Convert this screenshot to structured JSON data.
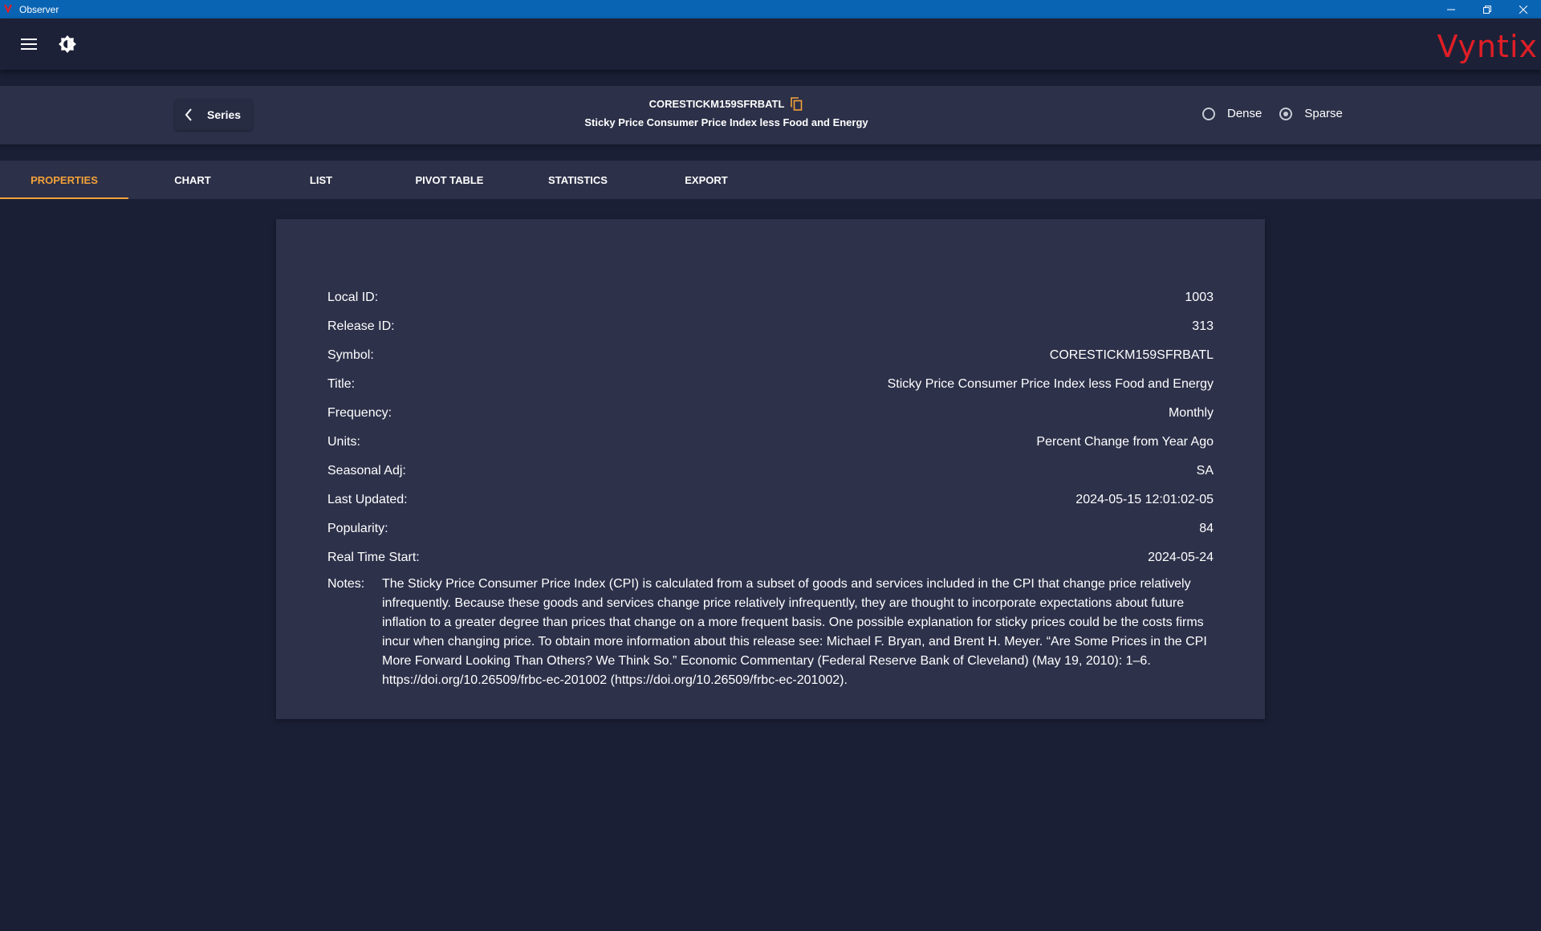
{
  "window": {
    "title": "Observer"
  },
  "appbar": {
    "logo_text": "Vyntix",
    "logo_color": "#e01e26"
  },
  "series_header": {
    "back_label": "Series",
    "symbol": "CORESTICKM159SFRBATL",
    "title": "Sticky Price Consumer Price Index less Food and Energy",
    "density_options": [
      {
        "label": "Dense",
        "selected": false
      },
      {
        "label": "Sparse",
        "selected": true
      }
    ]
  },
  "tabs": [
    {
      "label": "PROPERTIES",
      "active": true
    },
    {
      "label": "CHART",
      "active": false
    },
    {
      "label": "LIST",
      "active": false
    },
    {
      "label": "PIVOT TABLE",
      "active": false
    },
    {
      "label": "STATISTICS",
      "active": false
    },
    {
      "label": "EXPORT",
      "active": false
    }
  ],
  "properties": [
    {
      "label": "Local ID:",
      "value": "1003"
    },
    {
      "label": "Release ID:",
      "value": "313"
    },
    {
      "label": "Symbol:",
      "value": "CORESTICKM159SFRBATL"
    },
    {
      "label": "Title:",
      "value": "Sticky Price Consumer Price Index less Food and Energy"
    },
    {
      "label": "Frequency:",
      "value": "Monthly"
    },
    {
      "label": "Units:",
      "value": "Percent Change from Year Ago"
    },
    {
      "label": "Seasonal Adj:",
      "value": "SA"
    },
    {
      "label": "Last Updated:",
      "value": "2024-05-15 12:01:02-05"
    },
    {
      "label": "Popularity:",
      "value": "84"
    },
    {
      "label": "Real Time Start:",
      "value": "2024-05-24"
    }
  ],
  "notes": {
    "label": "Notes:",
    "text": "The Sticky Price Consumer Price Index (CPI) is calculated from a subset of goods and services included in the CPI that change price relatively infrequently. Because these goods and services change price relatively infrequently, they are thought to incorporate expectations about future inflation to a greater degree than prices that change on a more frequent basis. One possible explanation for sticky prices could be the costs firms incur when changing price. To obtain more information about this release see: Michael F. Bryan, and Brent H. Meyer. “Are Some Prices in the CPI More Forward Looking Than Others? We Think So.” Economic Commentary (Federal Reserve Bank of Cleveland) (May 19, 2010): 1–6. https://doi.org/10.26509/frbc-ec-201002 (https://doi.org/10.26509/frbc-ec-201002)."
  },
  "colors": {
    "titlebar": "#0a64b4",
    "background": "#1b1f35",
    "panel": "#2c3048",
    "accent": "#f2a23a"
  }
}
